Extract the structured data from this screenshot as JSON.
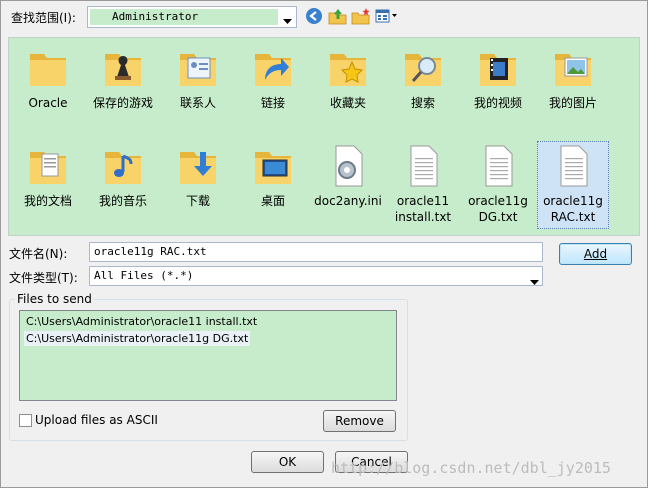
{
  "toolbar": {
    "lookin_label": "查找范围(I):",
    "lookin_value": "Administrator"
  },
  "files": [
    {
      "label": "Oracle",
      "icon": "folder-icon"
    },
    {
      "label": "保存的游戏",
      "icon": "saved-games-folder-icon"
    },
    {
      "label": "联系人",
      "icon": "contacts-folder-icon"
    },
    {
      "label": "链接",
      "icon": "links-folder-icon"
    },
    {
      "label": "收藏夹",
      "icon": "favorites-folder-icon"
    },
    {
      "label": "搜索",
      "icon": "searches-folder-icon"
    },
    {
      "label": "我的视频",
      "icon": "videos-folder-icon"
    },
    {
      "label": "我的图片",
      "icon": "pictures-folder-icon"
    },
    {
      "label": "我的文档",
      "icon": "documents-folder-icon"
    },
    {
      "label": "我的音乐",
      "icon": "music-folder-icon"
    },
    {
      "label": "下载",
      "icon": "downloads-folder-icon"
    },
    {
      "label": "桌面",
      "icon": "desktop-folder-icon"
    },
    {
      "label": "doc2any.ini",
      "icon": "settings-file-icon"
    },
    {
      "label": "oracle11 install.txt",
      "icon": "text-file-icon"
    },
    {
      "label": "oracle11g DG.txt",
      "icon": "text-file-icon"
    },
    {
      "label": "oracle11g RAC.txt",
      "icon": "text-file-icon"
    }
  ],
  "form": {
    "filename_label": "文件名(N):",
    "filename_value": "oracle11g RAC.txt",
    "filetype_label": "文件类型(T):",
    "filetype_value": "All Files (*.*)",
    "add_label": "Add"
  },
  "send": {
    "group_title": "Files to send",
    "items": [
      "C:\\Users\\Administrator\\oracle11 install.txt",
      "C:\\Users\\Administrator\\oracle11g DG.txt"
    ],
    "ascii_label": "Upload files as ASCII",
    "remove_label": "Remove"
  },
  "buttons": {
    "ok_label": "OK",
    "cancel_label": "Cancel"
  },
  "watermark": "http://blog.csdn.net/dbl_jy2015",
  "colors": {
    "pane_bg": "#c7eccb",
    "folder": "#f2c44e",
    "selection": "#cfe3f6"
  }
}
